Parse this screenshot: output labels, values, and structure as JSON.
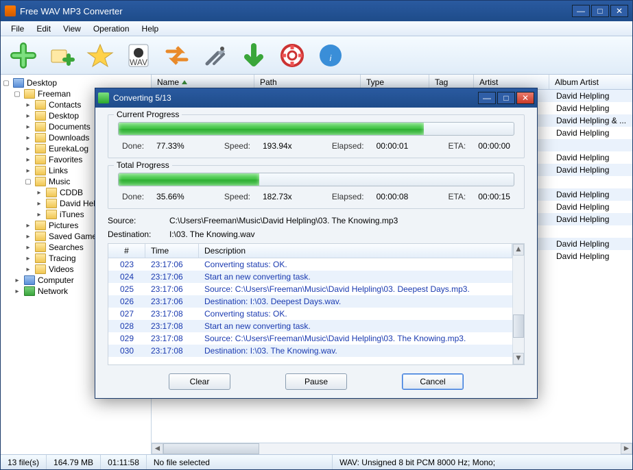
{
  "window": {
    "title": "Free WAV MP3 Converter"
  },
  "menu": {
    "file": "File",
    "edit": "Edit",
    "view": "View",
    "operation": "Operation",
    "help": "Help"
  },
  "tree": {
    "root": "Desktop",
    "user": "Freeman",
    "items": [
      "Contacts",
      "Desktop",
      "Documents",
      "Downloads",
      "EurekaLog",
      "Favorites",
      "Links",
      "Music"
    ],
    "music_children": [
      "CDDB",
      "David Helpling",
      "iTunes"
    ],
    "rest": [
      "Pictures",
      "Saved Games",
      "Searches",
      "Tracing",
      "Videos"
    ],
    "computer": "Computer",
    "network": "Network"
  },
  "columns": {
    "name": "Name",
    "path": "Path",
    "type": "Type",
    "tag": "Tag",
    "artist": "Artist",
    "album_artist": "Album Artist"
  },
  "artists": [
    "David Helpling",
    "David Helpling",
    "David Helpling & ...",
    "David Helpling",
    "",
    "David Helpling",
    "David Helpling",
    "",
    "David Helpling",
    "David Helpling",
    "David Helpling",
    "",
    "David Helpling",
    "David Helpling"
  ],
  "status": {
    "file_count": "13 file(s)",
    "size": "164.79 MB",
    "duration": "01:11:58",
    "selected": "No file selected",
    "format": "WAV:   Unsigned 8 bit PCM  8000 Hz;  Mono;"
  },
  "dialog": {
    "title": "Converting 5/13",
    "current": {
      "label": "Current Progress",
      "done_label": "Done:",
      "done_value": "77.33%",
      "speed_label": "Speed:",
      "speed_value": "193.94x",
      "elapsed_label": "Elapsed:",
      "elapsed_value": "00:00:01",
      "eta_label": "ETA:",
      "eta_value": "00:00:00",
      "percent": 77.33
    },
    "total": {
      "label": "Total Progress",
      "done_label": "Done:",
      "done_value": "35.66%",
      "speed_label": "Speed:",
      "speed_value": "182.73x",
      "elapsed_label": "Elapsed:",
      "elapsed_value": "00:00:08",
      "eta_label": "ETA:",
      "eta_value": "00:00:15",
      "percent": 35.66
    },
    "source_label": "Source:",
    "source_value": "C:\\Users\\Freeman\\Music\\David Helpling\\03. The Knowing.mp3",
    "destination_label": "Destination:",
    "destination_value": "I:\\03. The Knowing.wav",
    "log_cols": {
      "num": "#",
      "time": "Time",
      "desc": "Description"
    },
    "log": [
      {
        "n": "023",
        "t": "23:17:06",
        "d": "Converting status: OK."
      },
      {
        "n": "024",
        "t": "23:17:06",
        "d": "Start an new converting task."
      },
      {
        "n": "025",
        "t": "23:17:06",
        "d": "Source:  C:\\Users\\Freeman\\Music\\David Helpling\\03. Deepest Days.mp3."
      },
      {
        "n": "026",
        "t": "23:17:06",
        "d": "Destination: I:\\03. Deepest Days.wav."
      },
      {
        "n": "027",
        "t": "23:17:08",
        "d": "Converting status: OK."
      },
      {
        "n": "028",
        "t": "23:17:08",
        "d": "Start an new converting task."
      },
      {
        "n": "029",
        "t": "23:17:08",
        "d": "Source:  C:\\Users\\Freeman\\Music\\David Helpling\\03. The Knowing.mp3."
      },
      {
        "n": "030",
        "t": "23:17:08",
        "d": "Destination: I:\\03. The Knowing.wav."
      }
    ],
    "buttons": {
      "clear": "Clear",
      "pause": "Pause",
      "cancel": "Cancel"
    }
  }
}
